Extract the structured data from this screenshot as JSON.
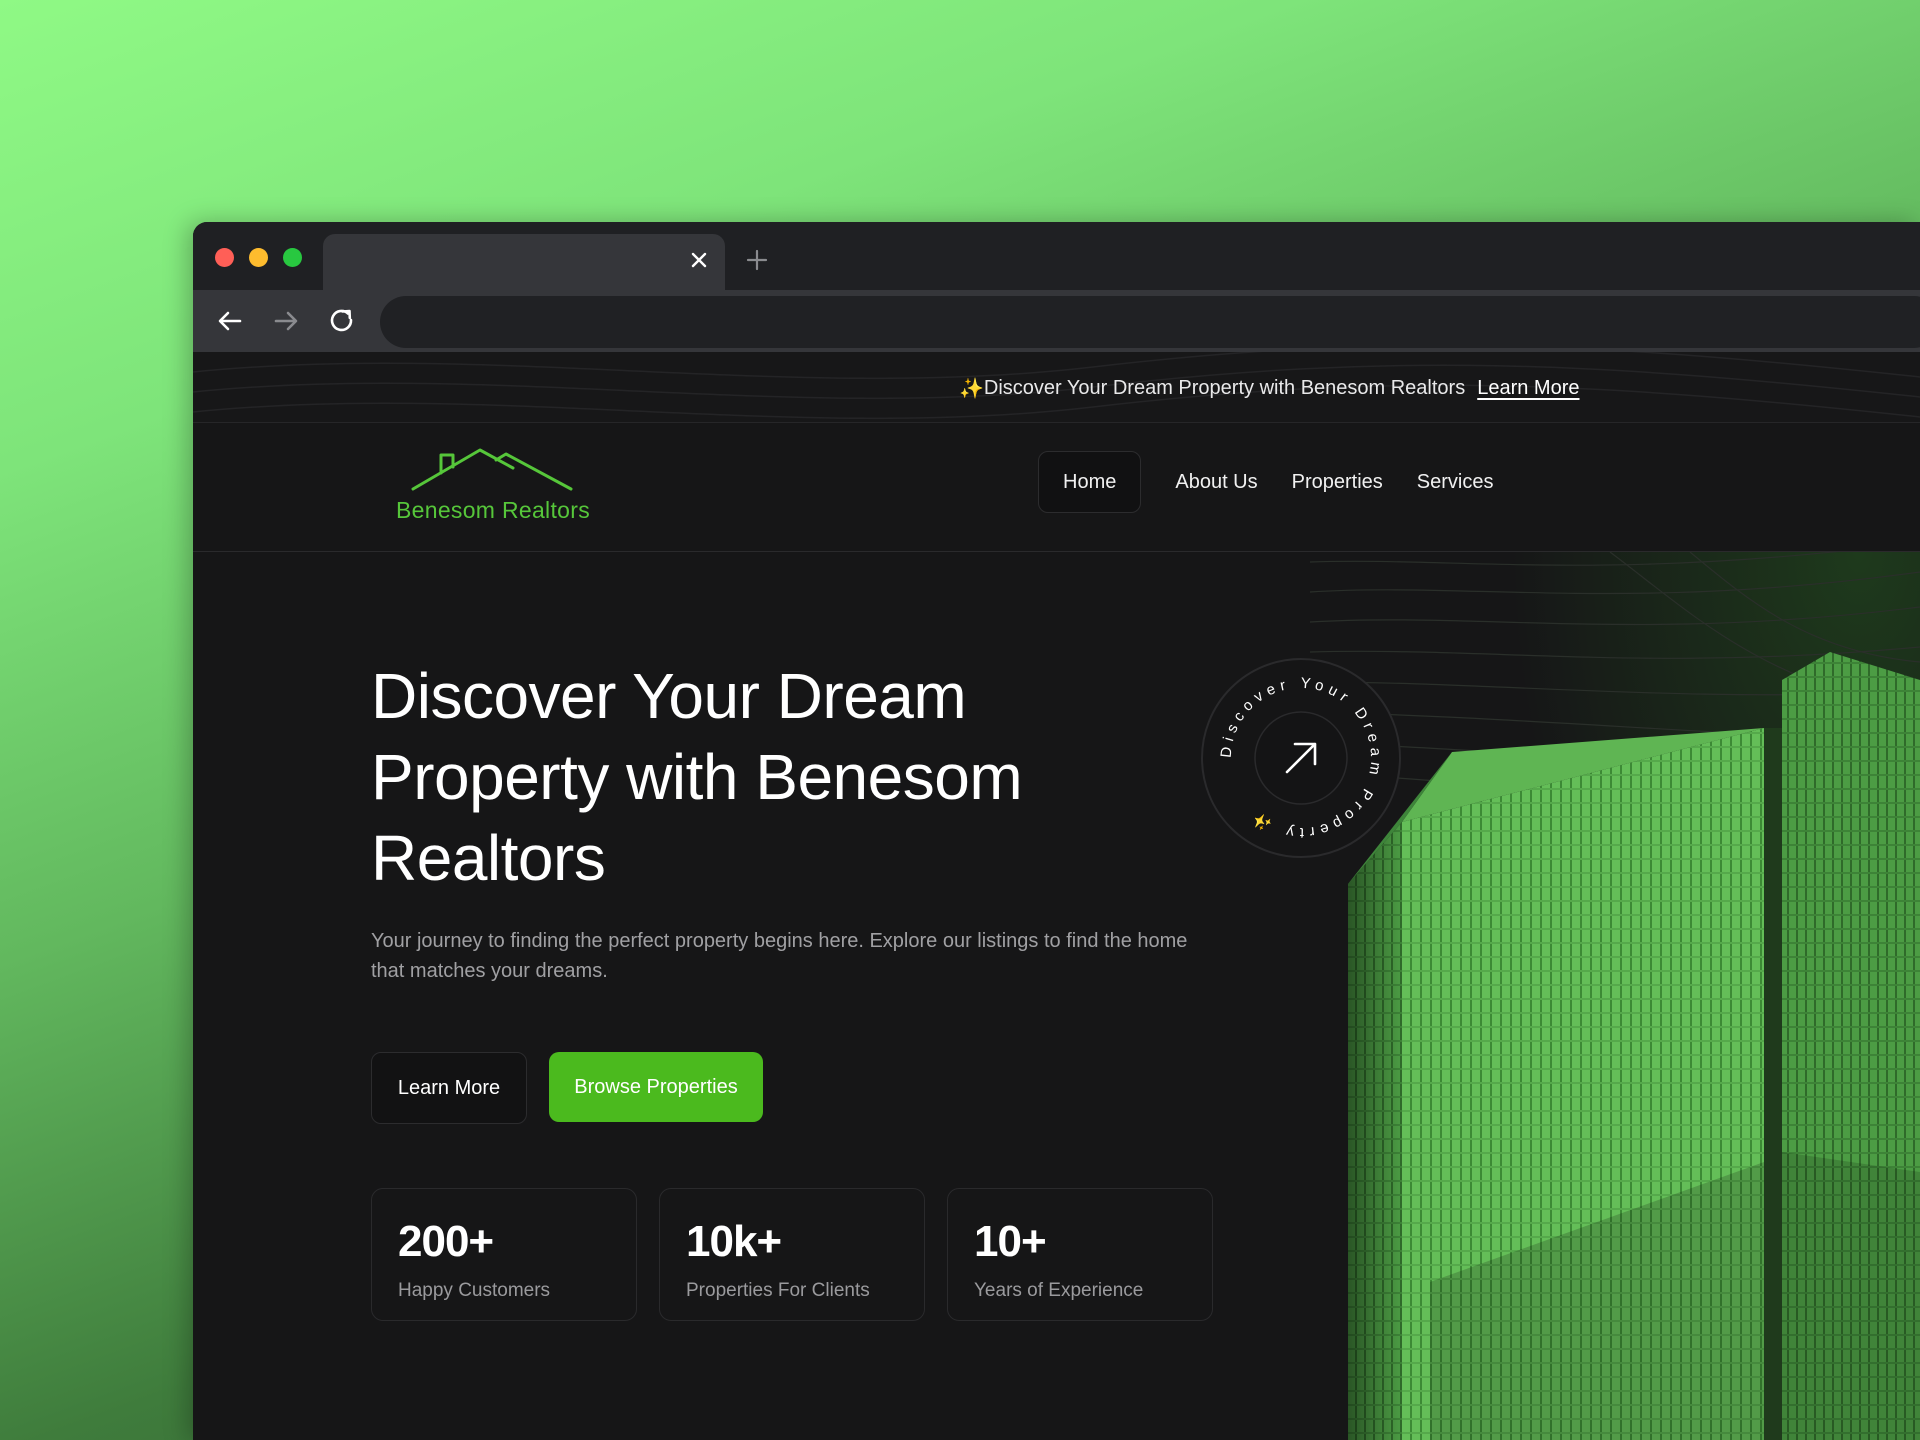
{
  "browser": {
    "tab_close_icon": "close-icon",
    "new_tab_icon": "plus-icon",
    "back_icon": "arrow-left-icon",
    "forward_icon": "arrow-right-icon",
    "reload_icon": "reload-icon",
    "url": ""
  },
  "announcement": {
    "sparkle": "✨",
    "text": "Discover Your Dream Property with Benesom Realtors",
    "link": "Learn More"
  },
  "header": {
    "logo_text": "Benesom Realtors",
    "nav": [
      {
        "label": "Home",
        "active": true
      },
      {
        "label": "About Us"
      },
      {
        "label": "Properties"
      },
      {
        "label": "Services"
      }
    ]
  },
  "hero": {
    "title_lines": [
      "Discover Your Dream",
      "Property with Benesom",
      "Realtors"
    ],
    "subtitle_lines": [
      "Your journey to finding the perfect property begins here. Explore our listings to find the home",
      "that matches your dreams."
    ],
    "learn_more": "Learn More",
    "browse": "Browse Properties",
    "badge_text": "Discover Your Dream Property ✨",
    "stats": [
      {
        "value": "200+",
        "label": "Happy Customers"
      },
      {
        "value": "10k+",
        "label": "Properties For Clients"
      },
      {
        "value": "10+",
        "label": "Years of Experience"
      }
    ]
  },
  "colors": {
    "accent": "#4bba1e",
    "logo": "#56c63a",
    "background": "#161617",
    "browser_chrome": "#1f2023"
  }
}
